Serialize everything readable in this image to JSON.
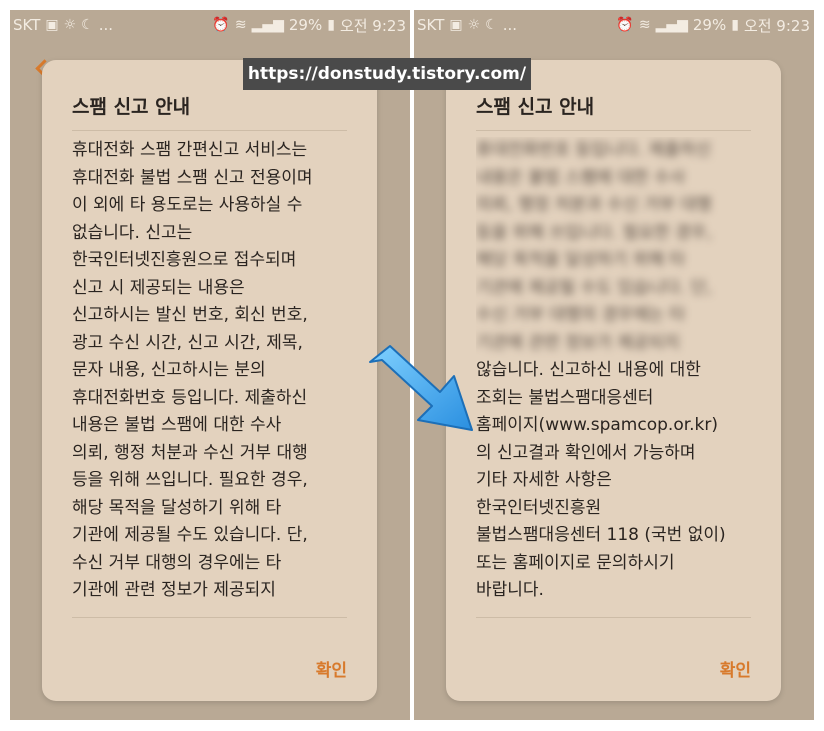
{
  "status_bar": {
    "carrier": "SKT",
    "more": "...",
    "battery": "29%",
    "time": "오전 9:23"
  },
  "watermark_url": "https://donstudy.tistory.com/",
  "left_dialog": {
    "title": "스팸 신고 안내",
    "lines": [
      "휴대전화 스팸 간편신고 서비스는",
      "휴대전화 불법 스팸 신고 전용이며",
      "이 외에 타 용도로는 사용하실 수",
      "없습니다. 신고는",
      "한국인터넷진흥원으로 접수되며",
      "신고 시 제공되는 내용은",
      "신고하시는 발신 번호, 회신 번호,",
      "광고 수신 시간, 신고 시간, 제목,",
      "문자 내용, 신고하시는 분의",
      "휴대전화번호 등입니다. 제출하신",
      "내용은 불법 스팸에 대한 수사",
      "의뢰, 행정 처분과 수신 거부 대행",
      "등을 위해 쓰입니다. 필요한 경우,",
      "해당 목적을 달성하기 위해 타",
      "기관에 제공될 수도 있습니다. 단,",
      "수신 거부 대행의 경우에는 타",
      "기관에 관련 정보가 제공되지"
    ],
    "ok_label": "확인"
  },
  "right_dialog": {
    "title": "스팸 신고 안내",
    "blurred_lines": [
      "휴대전화번호 등입니다. 제출하신",
      "내용은 불법 스팸에 대한 수사",
      "의뢰, 행정 처분과 수신 거부 대행",
      "등을 위해 쓰입니다. 필요한 경우,",
      "해당 목적을 달성하기 위해 타",
      "기관에 제공될 수도 있습니다. 단,",
      "수신 거부 대행의 경우에는 타",
      "기관에 관련 정보가 제공되지"
    ],
    "lines": [
      "않습니다. 신고하신 내용에 대한",
      "조회는 불법스팸대응센터",
      "홈페이지(www.spamcop.or.kr)",
      "의 신고결과 확인에서 가능하며",
      "기타 자세한 사항은",
      "한국인터넷진흥원",
      "불법스팸대응센터 118 (국번 없이)",
      "또는 홈페이지로 문의하시기",
      "바랍니다."
    ],
    "ok_label": "확인"
  },
  "colors": {
    "backdrop": "#b9a995",
    "dialog_bg": "#e3d2be",
    "accent": "#d87a2c",
    "arrow": "#3fa9f5"
  }
}
